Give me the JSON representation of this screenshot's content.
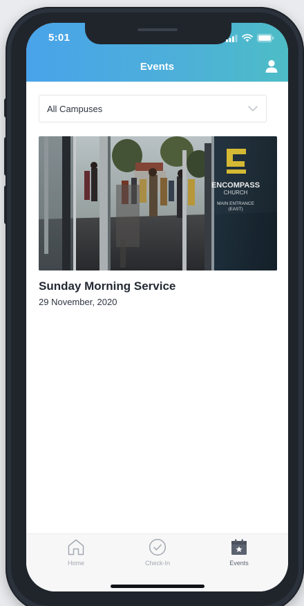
{
  "status_bar": {
    "time": "5:01"
  },
  "header": {
    "title": "Events"
  },
  "campus_filter": {
    "selected": "All Campuses"
  },
  "events": [
    {
      "title": "Sunday Morning Service",
      "date": "29 November, 2020",
      "image_sign": {
        "name_line1": "ENCOMPASS",
        "name_line2": "CHURCH",
        "sub_line1": "MAIN ENTRANCE",
        "sub_line2": "(EAST)"
      }
    }
  ],
  "tabs": [
    {
      "label": "Home",
      "icon": "home-icon",
      "active": false
    },
    {
      "label": "Check-In",
      "icon": "check-circle-icon",
      "active": false
    },
    {
      "label": "Events",
      "icon": "calendar-star-icon",
      "active": true
    }
  ],
  "colors": {
    "header_gradient_start": "#49a3ea",
    "header_gradient_end": "#4dbdc6",
    "brand_yellow": "#e8c93a",
    "tab_active": "#5b6270",
    "tab_inactive": "#a3a8b0"
  }
}
